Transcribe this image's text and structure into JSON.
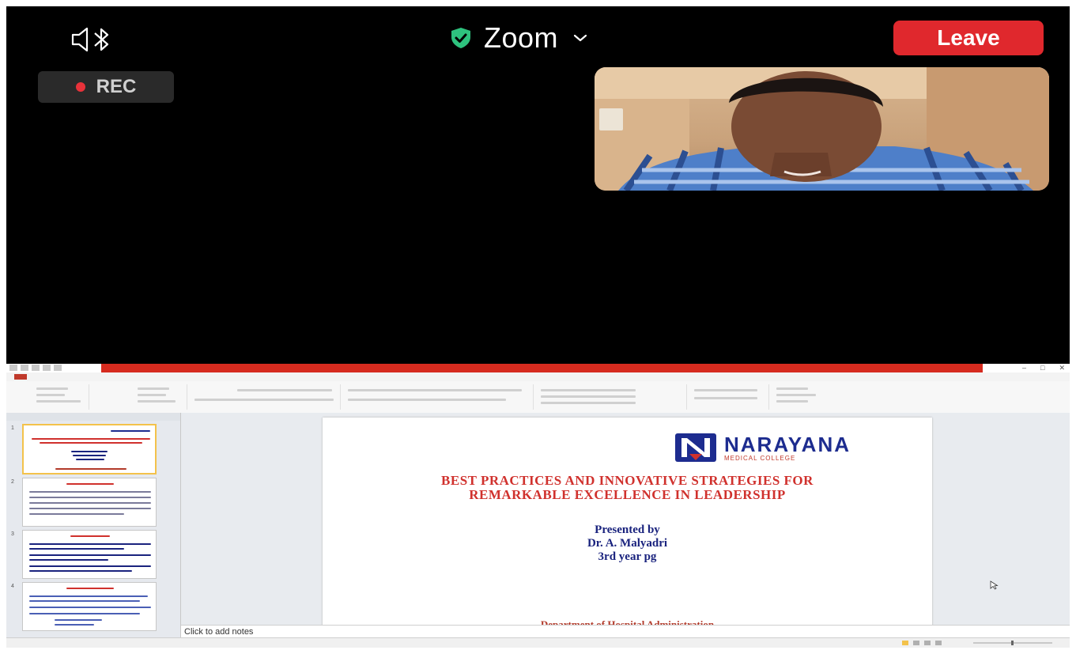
{
  "zoom": {
    "app_title": "Zoom",
    "leave_label": "Leave",
    "rec_label": "REC",
    "icons": [
      "speaker-bluetooth-icon",
      "shield-check-icon",
      "chevron-down-icon",
      "record-dot-icon"
    ],
    "colors": {
      "leave": "#e0282d",
      "shield": "#2ec27e",
      "rec_dot": "#e8323a"
    }
  },
  "ppt": {
    "logo": {
      "name": "NARAYANA",
      "subtitle": "MEDICAL COLLEGE"
    },
    "slide": {
      "title_line1": "BEST PRACTICES AND INNOVATIVE STRATEGIES FOR",
      "title_line2": "REMARKABLE EXCELLENCE IN LEADERSHIP",
      "presented_by": "Presented by",
      "presenter": "Dr. A. Malyadri",
      "year": "3rd year pg",
      "department": "Department  of Hospital Administration"
    },
    "thumbnail_numbers": [
      "1",
      "2",
      "3",
      "4"
    ],
    "notes_placeholder": "Click to add notes",
    "colors": {
      "title_red": "#d0312d",
      "navy": "#1a237e",
      "brand_blue": "#1d2c8f",
      "tab_red": "#d62b1f",
      "selected_thumb": "#f3c24b"
    }
  }
}
